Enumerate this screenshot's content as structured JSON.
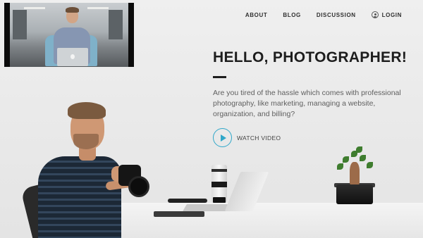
{
  "nav": {
    "links": [
      {
        "label": "ABOUT"
      },
      {
        "label": "BLOG"
      },
      {
        "label": "DISCUSSION"
      }
    ],
    "login_label": "LOGIN",
    "login_icon": "user-icon"
  },
  "hero": {
    "title": "HELLO, PHOTOGRAPHER!",
    "body": "Are you tired of the hassle which comes with professional photography, like marketing, managing a website, organization, and billing?",
    "watch_label": "WATCH VIDEO",
    "watch_icon": "play-icon"
  },
  "colors": {
    "accent": "#2fa7c9",
    "title": "#1d1d1d",
    "body_text": "#5f5f5f",
    "background": "#ececec"
  }
}
